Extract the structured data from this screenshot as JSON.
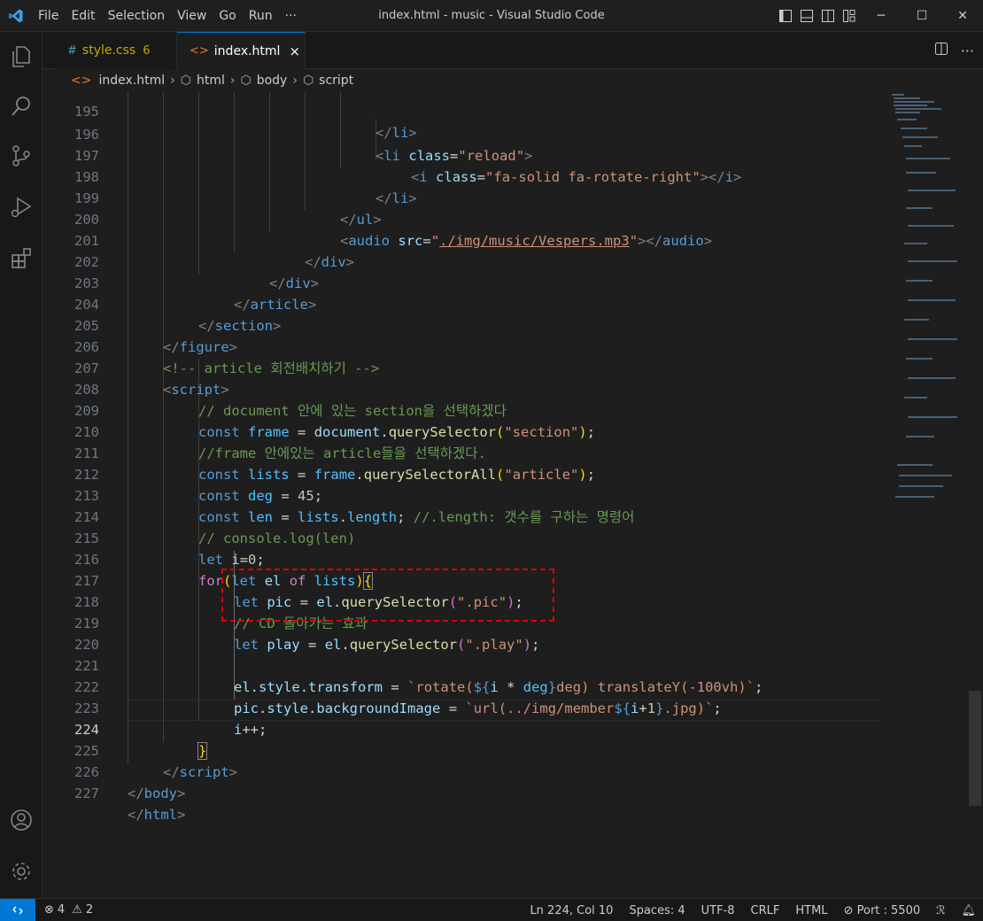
{
  "window": {
    "title": "index.html - music - Visual Studio Code",
    "menu": [
      "File",
      "Edit",
      "Selection",
      "View",
      "Go",
      "Run",
      "···"
    ]
  },
  "tabs": [
    {
      "label": "style.css",
      "badge": "6",
      "icon": "#",
      "active": false
    },
    {
      "label": "index.html",
      "icon": "<>",
      "active": true,
      "close": "×"
    }
  ],
  "breadcrumb": [
    "index.html",
    "html",
    "body",
    "script"
  ],
  "editor": {
    "first_line_partial": "195",
    "lines": [
      {
        "n": "196"
      },
      {
        "n": "197"
      },
      {
        "n": "198"
      },
      {
        "n": "199"
      },
      {
        "n": "200"
      },
      {
        "n": "201"
      },
      {
        "n": "202"
      },
      {
        "n": "203"
      },
      {
        "n": "204"
      },
      {
        "n": "205"
      },
      {
        "n": "206"
      },
      {
        "n": "207"
      },
      {
        "n": "208"
      },
      {
        "n": "209"
      },
      {
        "n": "210"
      },
      {
        "n": "211"
      },
      {
        "n": "212"
      },
      {
        "n": "213"
      },
      {
        "n": "214"
      },
      {
        "n": "215"
      },
      {
        "n": "216"
      },
      {
        "n": "217"
      },
      {
        "n": "218"
      },
      {
        "n": "219"
      },
      {
        "n": "220"
      },
      {
        "n": "221"
      },
      {
        "n": "222"
      },
      {
        "n": "223"
      },
      {
        "n": "224"
      },
      {
        "n": "225"
      },
      {
        "n": "226"
      },
      {
        "n": "227"
      }
    ],
    "current_line": "224"
  },
  "status": {
    "errors": "4",
    "warnings": "2",
    "position": "Ln 224, Col 10",
    "spaces": "Spaces: 4",
    "encoding": "UTF-8",
    "eol": "CRLF",
    "language": "HTML",
    "port": "Port : 5500"
  },
  "icons": {
    "activity": [
      "explorer-icon",
      "search-icon",
      "source-control-icon",
      "run-debug-icon",
      "extensions-icon",
      "account-icon",
      "settings-gear-icon"
    ]
  },
  "colors": {
    "accent": "#0078d4",
    "background": "#1e1e1e",
    "annotation": "#e00000"
  }
}
